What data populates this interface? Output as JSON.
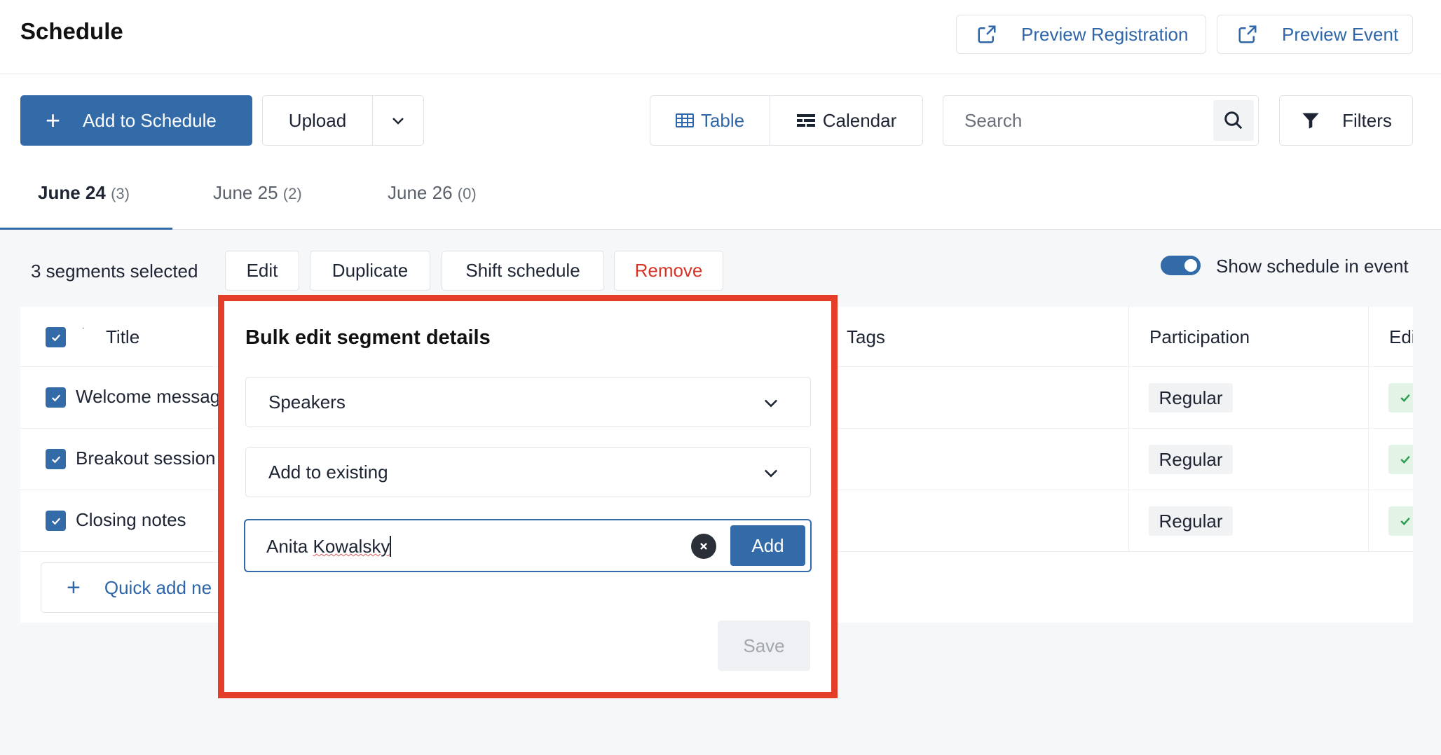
{
  "header": {
    "title": "Schedule",
    "preview_registration": "Preview Registration",
    "preview_event": "Preview Event"
  },
  "toolbar": {
    "add_to_schedule": "Add to Schedule",
    "upload": "Upload",
    "view_table": "Table",
    "view_calendar": "Calendar",
    "search_placeholder": "Search",
    "filters": "Filters"
  },
  "tabs": [
    {
      "label": "June 24",
      "count": "(3)",
      "active": true
    },
    {
      "label": "June 25",
      "count": "(2)",
      "active": false
    },
    {
      "label": "June 26",
      "count": "(0)",
      "active": false
    }
  ],
  "bulk_bar": {
    "selected_text": "3 segments selected",
    "edit": "Edit",
    "duplicate": "Duplicate",
    "shift_schedule": "Shift schedule",
    "remove": "Remove",
    "show_schedule_label": "Show schedule in event",
    "show_schedule_on": true
  },
  "table": {
    "columns": {
      "title": "Title",
      "tags": "Tags",
      "participation": "Participation",
      "edit_partial": "Edi"
    },
    "rows": [
      {
        "title": "Welcome messag",
        "participation": "Regular",
        "checked": true
      },
      {
        "title": "Breakout session",
        "participation": "Regular",
        "checked": true
      },
      {
        "title": "Closing notes",
        "participation": "Regular",
        "checked": true
      }
    ],
    "quick_add": "Quick add ne"
  },
  "popup": {
    "title": "Bulk edit segment details",
    "field_select": "Speakers",
    "mode_select": "Add to existing",
    "name_input_value_first": "Anita",
    "name_input_value_second": "Kowalsky",
    "add_button": "Add",
    "save_button": "Save",
    "outline_color": "#e43d2a"
  },
  "colors": {
    "accent": "#336aa8",
    "danger": "#d53325",
    "success_bg": "#e3f4e7"
  }
}
